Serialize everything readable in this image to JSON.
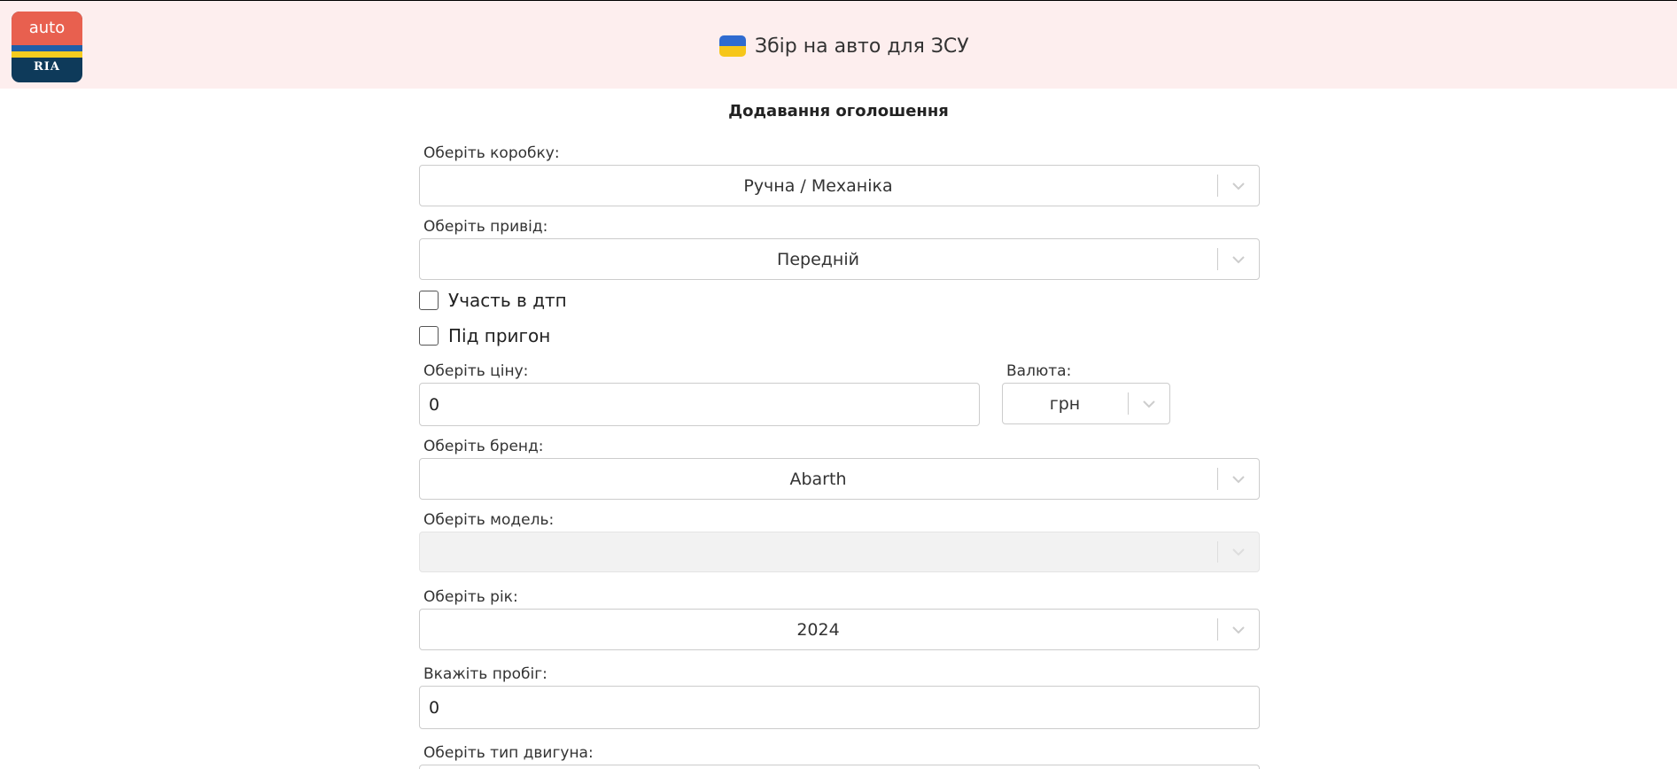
{
  "header": {
    "logo_text_top": "auto",
    "logo_text_bottom": "RIA",
    "title": "Збір на авто для ЗСУ",
    "flag_colors": {
      "top": "#2f6bd0",
      "bottom": "#f6c61a"
    },
    "background": "#fdeeee"
  },
  "page": {
    "heading": "Додавання оголошення"
  },
  "form": {
    "gearbox": {
      "label": "Оберіть коробку:",
      "value": "Ручна / Механіка"
    },
    "drive": {
      "label": "Оберіть привід:",
      "value": "Передній"
    },
    "accident": {
      "label": "Участь в дтп",
      "checked": false
    },
    "imported": {
      "label": "Під пригон",
      "checked": false
    },
    "price": {
      "label": "Оберіть ціну:",
      "value": "0"
    },
    "currency": {
      "label": "Валюта:",
      "value": "грн"
    },
    "brand": {
      "label": "Оберіть бренд:",
      "value": "Abarth"
    },
    "model": {
      "label": "Оберіть модель:",
      "value": "",
      "disabled": true
    },
    "year": {
      "label": "Оберіть рік:",
      "value": "2024"
    },
    "mileage": {
      "label": "Вкажіть пробіг:",
      "value": "0"
    },
    "engine_type": {
      "label": "Оберіть тип двигуна:"
    }
  },
  "icons": {
    "dropdown": "chevron-down-icon",
    "flag": "ukraine-flag-icon",
    "logo": "autoria-logo"
  }
}
